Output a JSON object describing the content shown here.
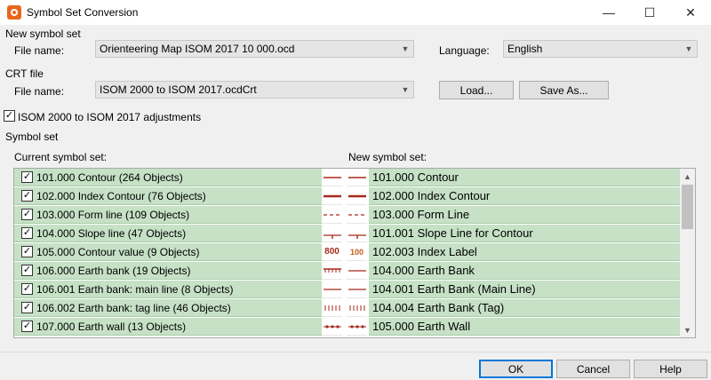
{
  "window": {
    "title": "Symbol Set Conversion",
    "controls": [
      "—",
      "☐",
      "✕"
    ]
  },
  "new_symbol_set": {
    "group_label": "New symbol set",
    "file_label": "File name:",
    "file_value": "Orienteering Map ISOM 2017 10 000.ocd",
    "language_label": "Language:",
    "language_value": "English"
  },
  "crt_file": {
    "group_label": "CRT file",
    "file_label": "File name:",
    "file_value": "ISOM 2000 to ISOM 2017.ocdCrt",
    "load_label": "Load...",
    "save_as_label": "Save As..."
  },
  "adjustments": {
    "label": "ISOM 2000 to ISOM 2017 adjustments",
    "checked": true
  },
  "symbol_set": {
    "group_label": "Symbol set",
    "current_header": "Current symbol set:",
    "new_header": "New symbol set:",
    "rows": [
      {
        "current": "101.000 Contour (264 Objects)",
        "new": "101.000 Contour",
        "prev_left": "contour",
        "prev_right": "contour"
      },
      {
        "current": "102.000 Index Contour (76 Objects)",
        "new": "102.000 Index Contour",
        "prev_left": "index",
        "prev_right": "index"
      },
      {
        "current": "103.000 Form line (109 Objects)",
        "new": "103.000 Form Line",
        "prev_left": "dash",
        "prev_right": "dash"
      },
      {
        "current": "104.000 Slope line (47 Objects)",
        "new": "101.001 Slope Line for Contour",
        "prev_left": "slope",
        "prev_right": "slope"
      },
      {
        "current": "105.000 Contour value (9 Objects)",
        "new": "102.003 Index Label",
        "prev_left": "800",
        "prev_right": "100"
      },
      {
        "current": "106.000 Earth bank (19 Objects)",
        "new": "104.000 Earth Bank",
        "prev_left": "bank",
        "prev_right": "line"
      },
      {
        "current": "106.001 Earth bank: main line (8 Objects)",
        "new": "104.001 Earth Bank (Main Line)",
        "prev_left": "line",
        "prev_right": "line"
      },
      {
        "current": "106.002 Earth bank: tag line (46 Objects)",
        "new": "104.004 Earth Bank (Tag)",
        "prev_left": "tags",
        "prev_right": "tags"
      },
      {
        "current": "107.000 Earth wall (13 Objects)",
        "new": "105.000 Earth Wall",
        "prev_left": "wall",
        "prev_right": "wall"
      }
    ]
  },
  "footer": {
    "ok_label": "OK",
    "cancel_label": "Cancel",
    "help_label": "Help"
  },
  "colors": {
    "row_green": "#c6e1c6",
    "symbol_brown": "#a52a1a",
    "accent": "#0078d7"
  }
}
